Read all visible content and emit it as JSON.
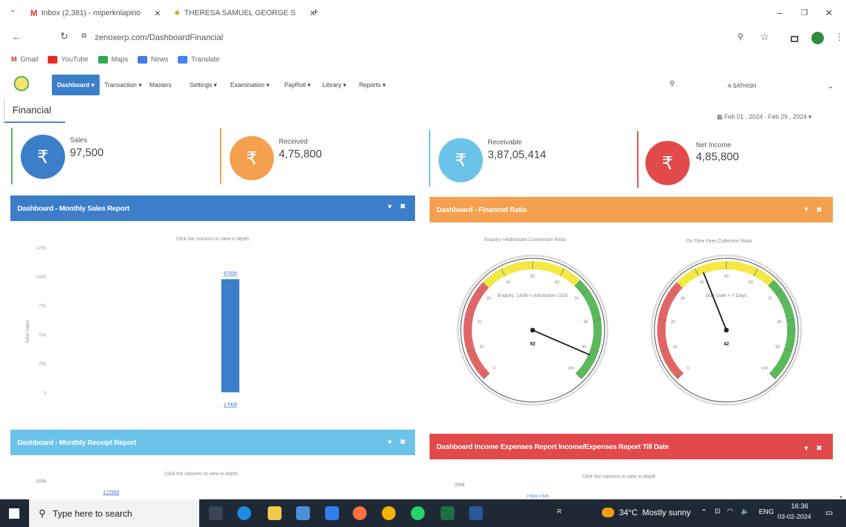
{
  "browser": {
    "tabs": [
      {
        "icon": "gmail-icon",
        "label": "Inbox (2,381) - miperknlapino"
      },
      {
        "icon": "site-icon",
        "label": "THERESA SAMUEL GEORGE S"
      }
    ],
    "url": "zenoxerp.com/DashboardFinancial",
    "bookmarks": [
      "Gmail",
      "YouTube",
      "Maps",
      "News",
      "Translate"
    ]
  },
  "nav": {
    "items": [
      "Dashboard",
      "Transaction",
      "Masters",
      "Settings",
      "Examination",
      "PayRoll",
      "Library",
      "Reports"
    ],
    "user": "A SATHISH"
  },
  "page": {
    "title": "Financial",
    "date_range": "Feb 01 , 2024 - Feb 29 , 2024"
  },
  "cards": [
    {
      "label": "Sales",
      "value": "97,500",
      "color": "#3b7ec9"
    },
    {
      "label": "Received",
      "value": "4,75,800",
      "color": "#f5a04f"
    },
    {
      "label": "Receivable",
      "value": "3,87,05,414",
      "color": "#6cc3ea"
    },
    {
      "label": "Net Income",
      "value": "4,85,800",
      "color": "#e2494a"
    }
  ],
  "panels": {
    "monthly_sales": "Dashboard - Monthly Sales Report",
    "financial_ratio": "Dashboard - Financial Ratio",
    "monthly_receipt": "Dashboard - Monthly Receipt Report",
    "income_expenses": "Dashboard Income Expenses Report Income/Expenses Report Till Date",
    "click_hint": "Click the columns to view in depth."
  },
  "chart_data": [
    {
      "type": "bar",
      "title": "Click the columns to view in depth.",
      "ylabel": "Total Sales",
      "yticks": [
        "0",
        "25k",
        "50k",
        "75k",
        "100k",
        "125k"
      ],
      "ylim": [
        0,
        125000
      ],
      "categories": [
        "1 FEB"
      ],
      "values": [
        97500
      ],
      "data_labels": [
        "97500"
      ]
    }
  ],
  "gauges": [
    {
      "title": "Enquiry->Admission Conversion Ratio",
      "subtitle": "Enquiry :1439-> Admission 1324",
      "value": 92,
      "ticks": [
        "0",
        "10",
        "20",
        "30",
        "40",
        "50",
        "60",
        "70",
        "80",
        "90",
        "100"
      ]
    },
    {
      "title": "On Time Fees Collection Ratio",
      "subtitle": "Due Date + 7 Days",
      "value": 42,
      "ticks": [
        "0",
        "10",
        "20",
        "30",
        "40",
        "50",
        "60",
        "70",
        "80",
        "90",
        "100"
      ]
    }
  ],
  "receipt_preview": {
    "ytick": "200k",
    "label": "177900"
  },
  "income_preview": {
    "ytick": "200k",
    "labels": [
      "176500",
      "17530"
    ]
  },
  "taskbar": {
    "search_placeholder": "Type here to search",
    "weather": "34°C  Mostly sunny",
    "lang": "ENG",
    "time": "16:36",
    "date": "03-02-2024"
  }
}
